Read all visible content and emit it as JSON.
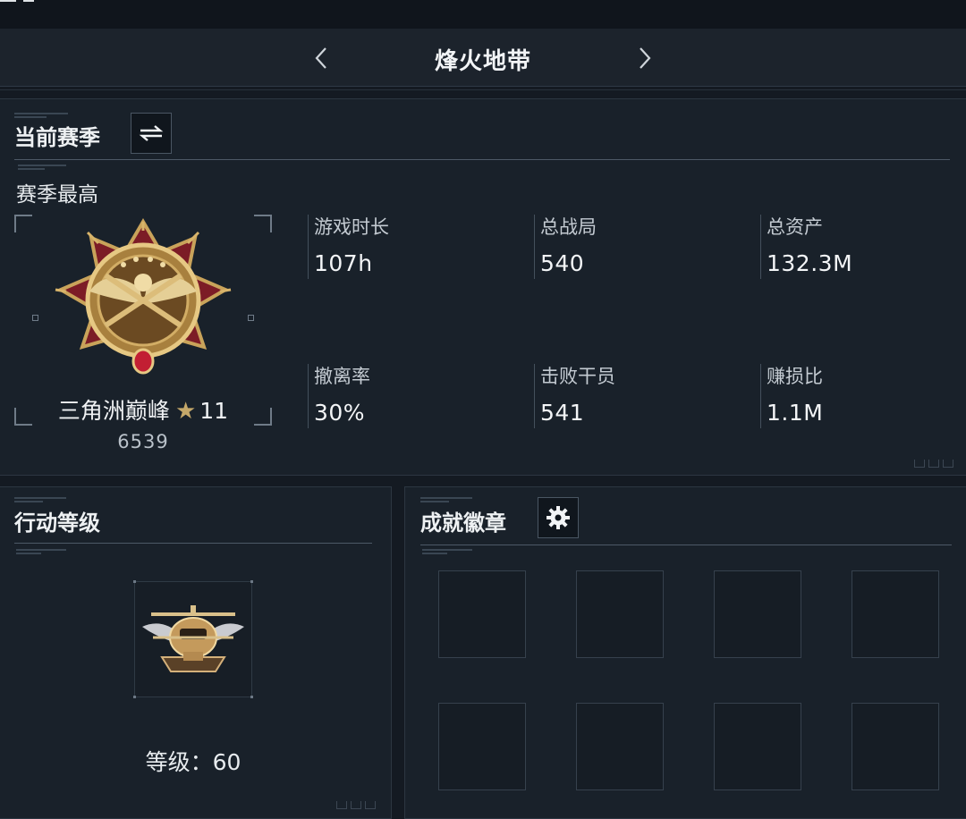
{
  "header": {
    "title": "烽火地带"
  },
  "season": {
    "title": "当前赛季",
    "subtitle": "赛季最高",
    "rank_name": "三角洲巅峰",
    "rank_stars": "11",
    "rank_points": "6539",
    "stats": [
      {
        "label": "游戏时长",
        "value": "107h"
      },
      {
        "label": "总战局",
        "value": "540"
      },
      {
        "label": "总资产",
        "value": "132.3M"
      },
      {
        "label": "撤离率",
        "value": "30%"
      },
      {
        "label": "击败干员",
        "value": "541"
      },
      {
        "label": "赚损比",
        "value": "1.1M"
      }
    ]
  },
  "operation_level": {
    "title": "行动等级",
    "level_text": "等级：60"
  },
  "achievements": {
    "title": "成就徽章",
    "slots": 8
  },
  "icons": {
    "prev": "chevron-left-icon",
    "next": "chevron-right-icon",
    "switch": "swap-icon",
    "settings": "gear-icon"
  },
  "colors": {
    "background": "#141a22",
    "panel": "#19212a",
    "medal_gold": "#c9a35a",
    "medal_red": "#8e1f2a"
  }
}
